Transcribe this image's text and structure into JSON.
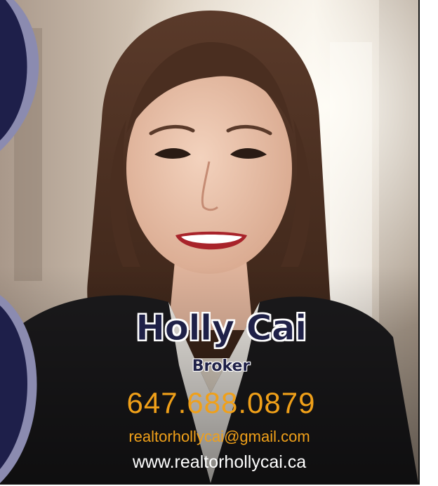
{
  "agent": {
    "name": "Holly Cai",
    "title": "Broker",
    "phone": "647.688.0879",
    "email": "realtorhollycai@gmail.com",
    "website": "www.realtorhollycai.ca"
  },
  "colors": {
    "navy": "#1f2148",
    "accent_orange": "#f0a019",
    "text_white": "#ffffff",
    "ribbon_lavender": "#8b8bb0"
  }
}
